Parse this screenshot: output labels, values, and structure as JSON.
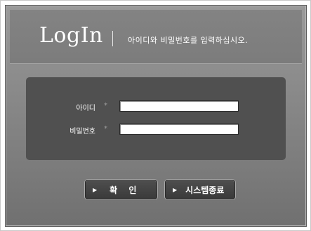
{
  "header": {
    "logo_text": "LogIn",
    "instruction": "아이디와 비밀번호를 입력하십시오."
  },
  "form": {
    "id_label": "아이디",
    "id_marker": "*",
    "id_value": "",
    "password_label": "비밀번호",
    "password_marker": "*",
    "password_value": ""
  },
  "buttons": {
    "arrow_icon": "triangle-right",
    "confirm_label": "확 인",
    "exit_label": "시스템종료"
  },
  "colors": {
    "panel": "#8d8d8d",
    "form_box": "#505050",
    "button": "#444444",
    "text": "#ffffff"
  }
}
